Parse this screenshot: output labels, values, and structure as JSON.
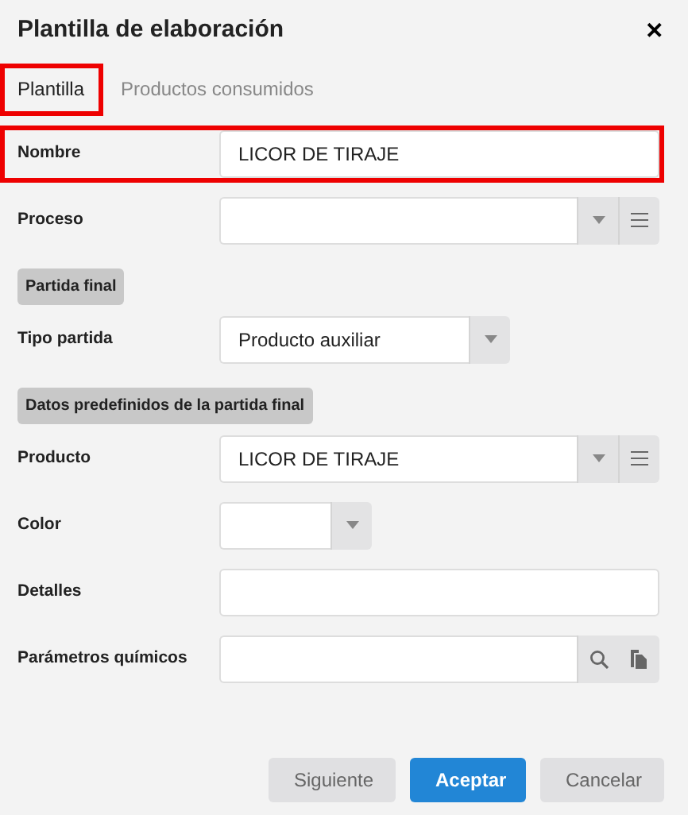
{
  "window": {
    "title": "Plantilla de elaboración",
    "close": "✕"
  },
  "tabs": [
    {
      "label": "Plantilla",
      "selected": true,
      "highlighted": true
    },
    {
      "label": "Productos consumidos",
      "selected": false,
      "highlighted": false
    }
  ],
  "rows": [
    {
      "kind": "text",
      "label": "Nombre",
      "value": "LICOR DE TIRAJE",
      "highlighted": true
    },
    {
      "kind": "combo-menu",
      "label": "Proceso",
      "value": ""
    },
    {
      "kind": "section",
      "label": "Partida final"
    },
    {
      "kind": "combo",
      "label": "Tipo partida",
      "value": "Producto auxiliar"
    },
    {
      "kind": "section",
      "label": "Datos predefinidos de la partida final"
    },
    {
      "kind": "combo-menu",
      "label": "Producto",
      "value": "LICOR DE TIRAJE"
    },
    {
      "kind": "combo",
      "label": "Color",
      "value": ""
    },
    {
      "kind": "text",
      "label": "Detalles",
      "value": ""
    },
    {
      "kind": "lookup",
      "label": "Parámetros químicos",
      "value": ""
    }
  ],
  "buttons": [
    {
      "label": "Siguiente",
      "kind": "secondary"
    },
    {
      "label": "Aceptar",
      "kind": "primary"
    },
    {
      "label": "Cancelar",
      "kind": "secondary"
    }
  ]
}
